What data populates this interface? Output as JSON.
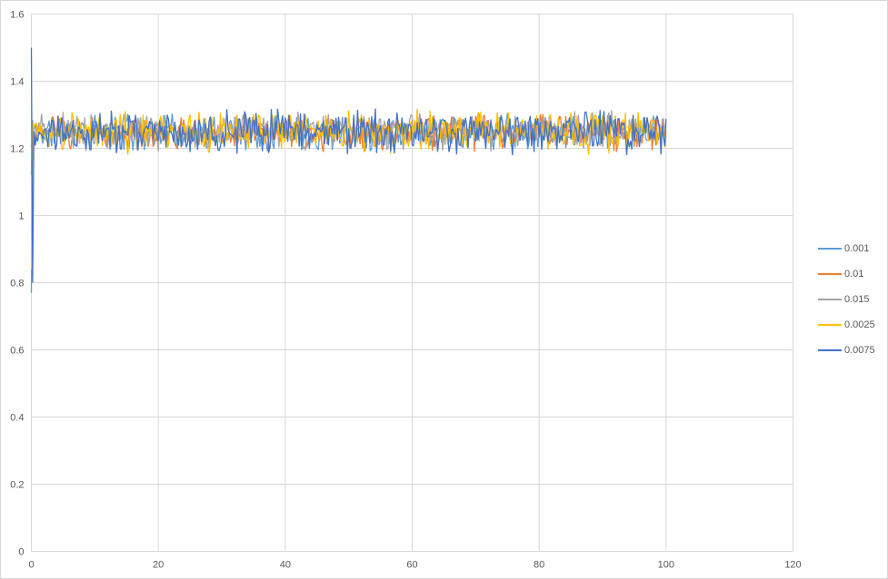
{
  "chart_data": {
    "type": "line",
    "title": "",
    "xlabel": "",
    "ylabel": "",
    "xlim": [
      0,
      120
    ],
    "ylim": [
      0,
      1.6
    ],
    "x_ticks": [
      0,
      20,
      40,
      60,
      80,
      100,
      120
    ],
    "x_tick_labels": [
      "0",
      "20",
      "40",
      "60",
      "80",
      "100",
      "120"
    ],
    "y_ticks": [
      0,
      0.2,
      0.4,
      0.6,
      0.8,
      1,
      1.2,
      1.4,
      1.6
    ],
    "y_tick_labels": [
      "0",
      "0.2",
      "0.4",
      "0.6",
      "0.8",
      "1",
      "1.2",
      "1.4",
      "1.6"
    ],
    "grid": true,
    "gridline_color": "#d9d9d9",
    "axis_label_color": "#595959",
    "legend_position": "right",
    "x_data_range": [
      0,
      100
    ],
    "points_per_series": 501,
    "noise_model": "dense random noise band around mean, approx 1.19 to 1.32, with brief transient at x=0",
    "series": [
      {
        "name": "0.001",
        "color": "#5b9bd5",
        "mean": 1.248,
        "amplitude": 0.045,
        "start": 0.77,
        "seed": 11
      },
      {
        "name": "0.01",
        "color": "#ed7d31",
        "mean": 1.246,
        "amplitude": 0.045,
        "start": 1.21,
        "seed": 23
      },
      {
        "name": "0.015",
        "color": "#a5a5a5",
        "mean": 1.252,
        "amplitude": 0.047,
        "start": 1.12,
        "seed": 37
      },
      {
        "name": "0.0025",
        "color": "#ffc000",
        "mean": 1.25,
        "amplitude": 0.052,
        "start": 0.84,
        "seed": 41
      },
      {
        "name": "0.0075",
        "color": "#4472c4",
        "mean": 1.25,
        "amplitude": 0.054,
        "start": 1.5,
        "second": 0.8,
        "seed": 59
      }
    ]
  }
}
